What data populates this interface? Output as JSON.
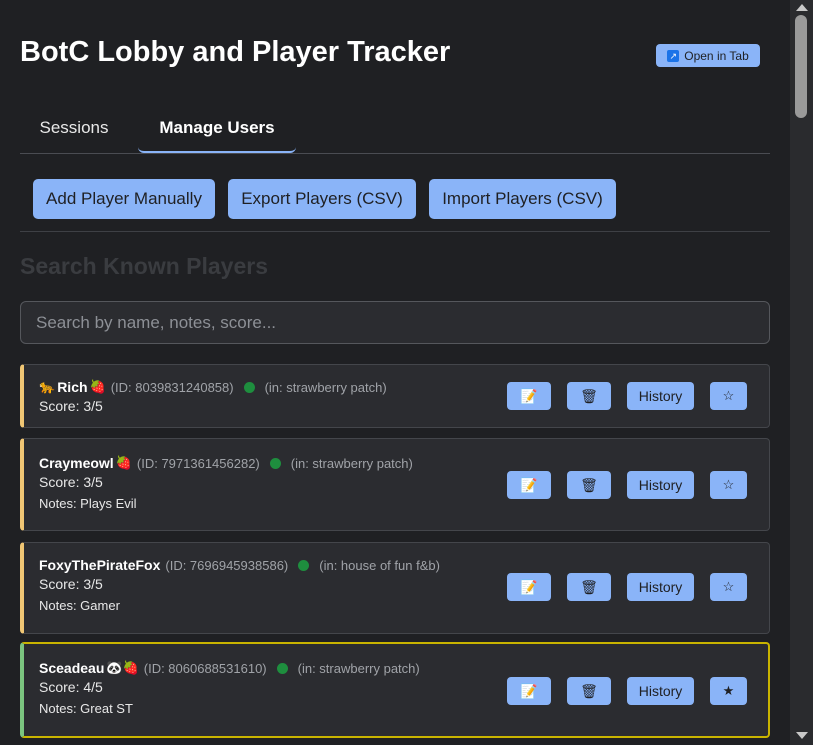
{
  "header": {
    "title": "BotC Lobby and Player Tracker",
    "open_tab_label": "Open in Tab"
  },
  "tabs": [
    {
      "label": "Sessions",
      "active": false
    },
    {
      "label": "Manage Users",
      "active": true
    }
  ],
  "actions": {
    "add_label": "Add Player Manually",
    "export_label": "Export Players (CSV)",
    "import_label": "Import Players (CSV)"
  },
  "search": {
    "heading": "Search Known Players",
    "placeholder": "Search by name, notes, score..."
  },
  "buttons": {
    "edit_icon": "📝",
    "delete_icon": "🗑",
    "history_label": "History",
    "star_empty": "☆",
    "star_filled": "★"
  },
  "players": [
    {
      "prefix": "🐆",
      "name": "Rich",
      "badges": "🍓",
      "id": "(ID: 8039831240858)",
      "location": "(in: strawberry patch)",
      "score": "Score: 3/5",
      "notes": "",
      "starred": false
    },
    {
      "prefix": "",
      "name": "Craymeowl",
      "badges": "🍓",
      "id": "(ID: 7971361456282)",
      "location": "(in: strawberry patch)",
      "score": "Score: 3/5",
      "notes": "Notes: Plays Evil",
      "starred": false
    },
    {
      "prefix": "",
      "name": "FoxyThePirateFox",
      "badges": "",
      "id": "(ID: 7696945938586)",
      "location": "(in: house of fun f&b)",
      "score": "Score: 3/5",
      "notes": "Notes: Gamer",
      "starred": false
    },
    {
      "prefix": "",
      "name": "Sceadeau",
      "badges": "🐼🍓",
      "id": "(ID: 8060688531610)",
      "location": "(in: strawberry patch)",
      "score": "Score: 4/5",
      "notes": "Notes: Great ST",
      "starred": true
    }
  ],
  "colors": {
    "accent": "#8ab4f8",
    "background": "#1f2023",
    "card": "#2b2c30",
    "online_dot": "#1e8e3e",
    "card_border_default": "#f0c674",
    "card_border_starred": "#7bc47f",
    "highlight_outline": "#c9b400"
  }
}
